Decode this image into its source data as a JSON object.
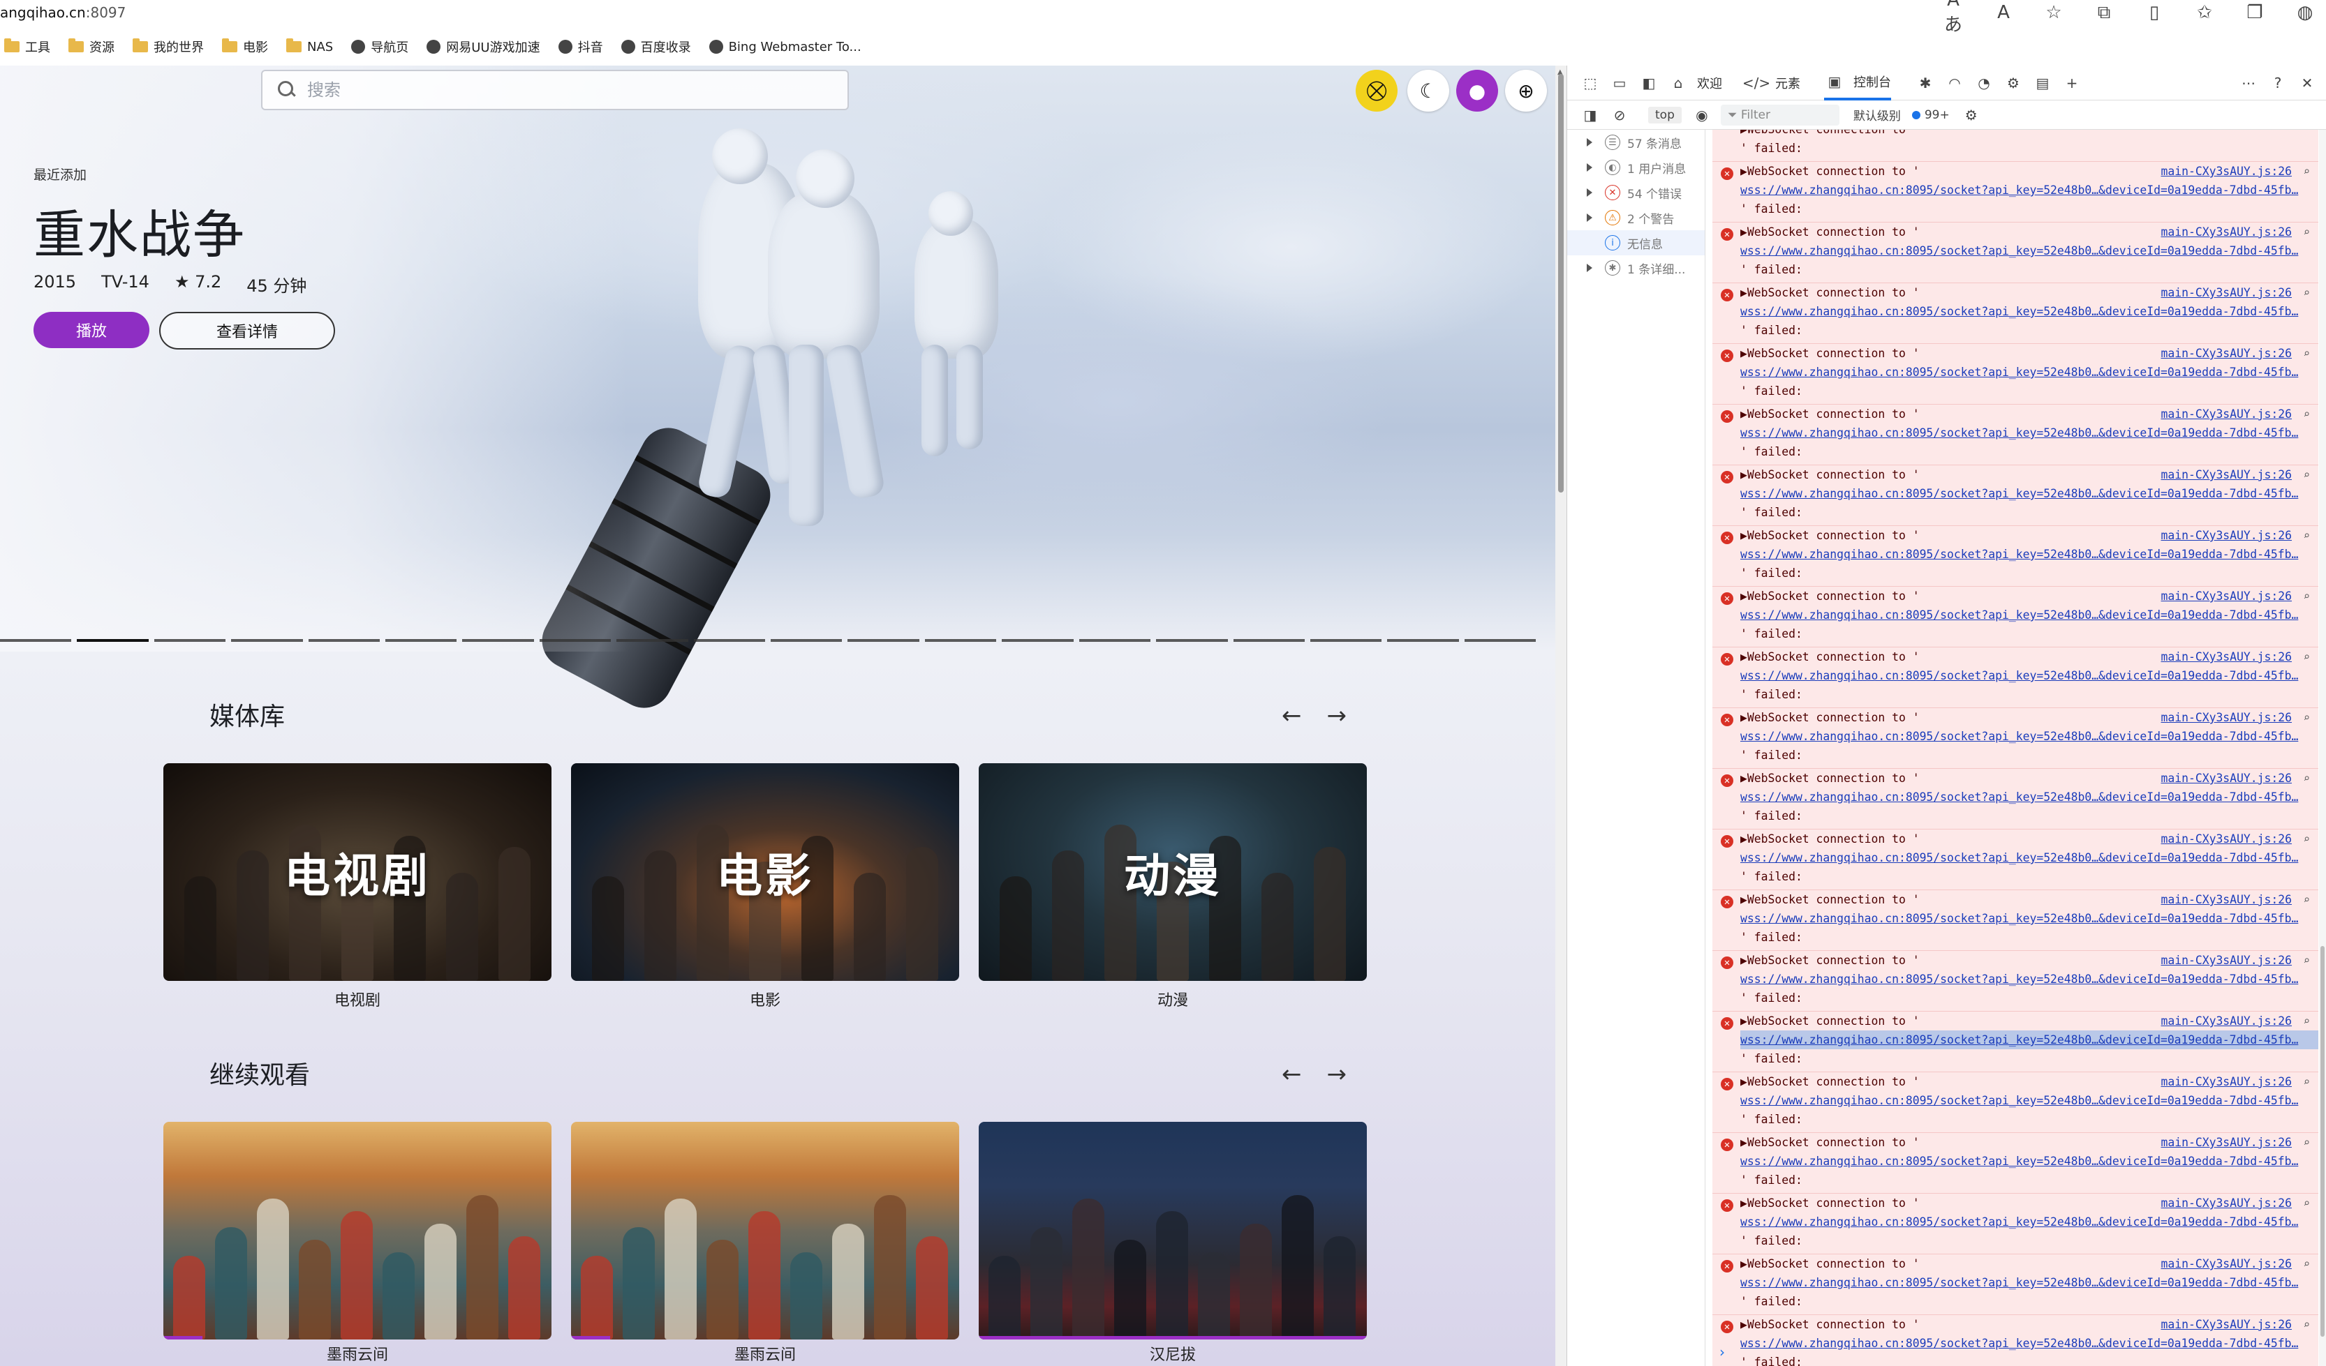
{
  "browser": {
    "url_prefix": "angqihao.cn",
    "url_port": ":8097",
    "bookmarks": [
      "工具",
      "资源",
      "我的世界",
      "电影",
      "NAS",
      "导航页",
      "网易UU游戏加速",
      "抖音",
      "百度收录",
      "Bing Webmaster To..."
    ]
  },
  "header": {
    "search_placeholder": "搜索"
  },
  "hero": {
    "recent_label": "最近添加",
    "title": "重水战争",
    "year": "2015",
    "rating_tag": "TV-14",
    "score": "★ 7.2",
    "duration": "45 分钟",
    "play_label": "播放",
    "details_label": "查看详情",
    "dots_count": 20,
    "active_dot": 1
  },
  "library": {
    "title": "媒体库",
    "prev": "←",
    "next": "→",
    "items": [
      {
        "overlay": "电视剧",
        "label": "电视剧"
      },
      {
        "overlay": "电影",
        "label": "电影"
      },
      {
        "overlay": "动漫",
        "label": "动漫"
      }
    ]
  },
  "continue": {
    "title": "继续观看",
    "prev": "←",
    "next": "→",
    "items": [
      {
        "label": "墨雨云间",
        "progress": 0.1
      },
      {
        "label": "墨雨云间",
        "progress": 0.1
      },
      {
        "label": "汉尼拔",
        "progress": 1.0
      }
    ]
  },
  "devtools": {
    "tabs": {
      "welcome": "欢迎",
      "elements": "元素",
      "console": "控制台"
    },
    "toolbar": {
      "context": "top",
      "filter_placeholder": "Filter",
      "level": "默认级别",
      "issues": "99+"
    },
    "sidebar": [
      {
        "label": "57 条消息",
        "icon": "list-icon"
      },
      {
        "label": "1 用户消息",
        "icon": "user-icon"
      },
      {
        "label": "54 个错误",
        "icon": "error-icon"
      },
      {
        "label": "2 个警告",
        "icon": "warning-icon"
      },
      {
        "label": "无信息",
        "icon": "info-icon"
      },
      {
        "label": "1 条详细...",
        "icon": "bug-icon"
      }
    ],
    "message": {
      "line1": "▶WebSocket connection to '",
      "line2": "wss://www.zhangqihao.cn:8095/socket?api_key=52e48b0…&deviceId=0a19edda-7dbd-45fb…",
      "line3": "' failed:",
      "source": "main-CXy3sAUY.js:26"
    },
    "partial_top": "▶WebSocket connection to '",
    "message_count": 20,
    "selected_index": 14,
    "prompt": "›"
  },
  "colors": {
    "accent": "#8e2ec3",
    "cast_button": "#f2d21c",
    "error_bg": "#fde8e8"
  }
}
